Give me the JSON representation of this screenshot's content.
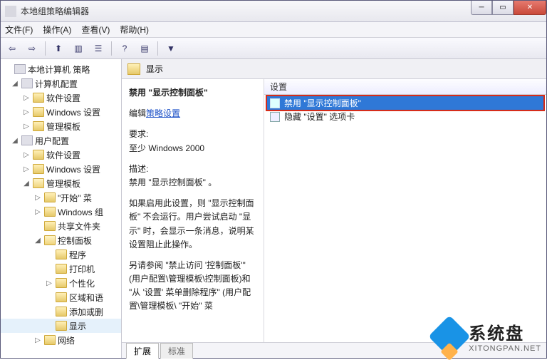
{
  "window": {
    "title": "本地组策略编辑器"
  },
  "menu": {
    "file": "文件(F)",
    "action": "操作(A)",
    "view": "查看(V)",
    "help": "帮助(H)"
  },
  "tree": {
    "root": "本地计算机 策略",
    "computer": "计算机配置",
    "c_soft": "软件设置",
    "c_win": "Windows 设置",
    "c_admin": "管理模板",
    "user": "用户配置",
    "u_soft": "软件设置",
    "u_win": "Windows 设置",
    "u_admin": "管理模板",
    "start": "\"开始\" 菜",
    "wincomp": "Windows 组",
    "shared": "共享文件夹",
    "cpanel": "控制面板",
    "programs": "程序",
    "printers": "打印机",
    "personal": "个性化",
    "region": "区域和语",
    "addrem": "添加或删",
    "display": "显示",
    "network": "网络"
  },
  "right": {
    "header": "显示",
    "desc_title": "禁用 \"显示控制面板\"",
    "edit_link": "策略设置",
    "edit_prefix": "编辑",
    "req_label": "要求:",
    "req_value": "至少 Windows 2000",
    "desc_label": "描述:",
    "desc_1": "禁用 \"显示控制面板\" 。",
    "desc_2": "如果启用此设置，则 \"显示控制面板\" 不会运行。用户尝试启动 \"显示\" 时，会显示一条消息，说明某设置阻止此操作。",
    "desc_3": "另请参阅 \"禁止访问 '控制面板'\" (用户配置\\管理模板\\控制面板)和 \"从 '设置' 菜单删除程序\" (用户配置\\管理模板\\ \"开始\" 菜"
  },
  "list": {
    "col_setting": "设置",
    "items": [
      {
        "label": "禁用 \"显示控制面板\"",
        "selected": true
      },
      {
        "label": "隐藏 \"设置\" 选项卡",
        "selected": false
      }
    ]
  },
  "tabs": {
    "extended": "扩展",
    "standard": "标准"
  },
  "watermark": {
    "name": "系统盘",
    "url": "XITONGPAN.NET"
  }
}
